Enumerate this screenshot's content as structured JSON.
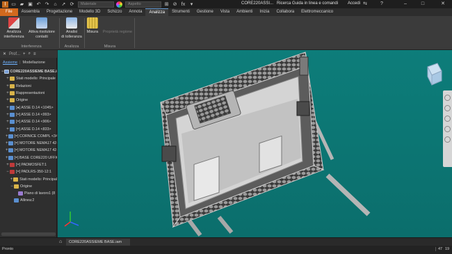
{
  "quick_access": {
    "material_placeholder": "Materiale",
    "appearance_placeholder": "Aspetto",
    "doc_title": "CORE220ASSI...",
    "search": "Ricerca Guida in linea e comandi",
    "user": "Accedi"
  },
  "tabs": [
    {
      "label": "File"
    },
    {
      "label": "Assembla"
    },
    {
      "label": "Progettazione"
    },
    {
      "label": "Modello 3D"
    },
    {
      "label": "Schizzo"
    },
    {
      "label": "Annota"
    },
    {
      "label": "Analizza"
    },
    {
      "label": "Strumenti"
    },
    {
      "label": "Gestione"
    },
    {
      "label": "Vista"
    },
    {
      "label": "Ambienti"
    },
    {
      "label": "Inizia"
    },
    {
      "label": "Collabora"
    },
    {
      "label": "Elettromeccanico"
    }
  ],
  "ribbon": {
    "btn1": [
      "Analizza",
      "interferenza"
    ],
    "btn2": [
      "Attiva risolutore",
      "contatti"
    ],
    "group1": "Interferenza",
    "btn3": [
      "Analisi",
      "di tolleranza"
    ],
    "group2": "Analizza",
    "btn4": [
      "Misura"
    ],
    "btn5": [
      "Proprietà regione"
    ],
    "group3": "Misura"
  },
  "browser": {
    "search_label": "Prof...",
    "tab_model": "Assieme",
    "tab_modeling": "Modellazione",
    "tree": [
      {
        "label": "CORE220ASSIEME BASE.iam",
        "icon": "asm",
        "indent": 0,
        "exp": "−"
      },
      {
        "label": "Stati modello: Principale",
        "icon": "folder",
        "indent": 1,
        "exp": "+"
      },
      {
        "label": "Relazioni",
        "icon": "folder",
        "indent": 1,
        "exp": "+"
      },
      {
        "label": "Rappresentazioni",
        "icon": "folder",
        "indent": 1,
        "exp": "+"
      },
      {
        "label": "Origine",
        "icon": "folder",
        "indent": 1,
        "exp": "+"
      },
      {
        "label": "[●] ASSE D.14 <1045>",
        "icon": "part",
        "indent": 1,
        "exp": "+"
      },
      {
        "label": "[=] ASSE D.14 <993>",
        "icon": "part",
        "indent": 1,
        "exp": "+"
      },
      {
        "label": "[=] ASSE D.14 <906>",
        "icon": "part",
        "indent": 1,
        "exp": "+"
      },
      {
        "label": "[=] ASSE D.14 <833>",
        "icon": "part",
        "indent": 1,
        "exp": "+"
      },
      {
        "label": "[=] CORNICE COMPL <34",
        "icon": "part",
        "indent": 1,
        "exp": "+"
      },
      {
        "label": "[=] MOTORE NEMA17 42-",
        "icon": "part",
        "indent": 1,
        "exp": "+"
      },
      {
        "label": "[=] MOTORE NEMA17 42-",
        "icon": "part",
        "indent": 1,
        "exp": "+"
      },
      {
        "label": "[=] BASE CORE220 UFFIC",
        "icon": "part",
        "indent": 1,
        "exp": "+"
      },
      {
        "label": "[=] PADMOSFET:1",
        "icon": "warn",
        "indent": 1,
        "exp": "+"
      },
      {
        "label": "[=] PADLRS-350-12:1",
        "icon": "warn",
        "indent": 1,
        "exp": "−"
      },
      {
        "label": "Stati modello: Principal",
        "icon": "folder",
        "indent": 2,
        "exp": "+"
      },
      {
        "label": "Origine",
        "icon": "folder",
        "indent": 2,
        "exp": "−"
      },
      {
        "label": "Piano di lavoro1 (8",
        "icon": "plane",
        "indent": 3,
        "exp": ""
      },
      {
        "label": "Allinea:2",
        "icon": "part",
        "indent": 2,
        "exp": ""
      }
    ]
  },
  "doc_tab": "CORE220ASSIEME BASE.iam",
  "status": {
    "text": "Pronto",
    "n1": "47",
    "n2": "19"
  },
  "colors": {
    "viewport": "#0d7d7a",
    "file_tab": "#d2691e",
    "accent": "#6fb3ff"
  }
}
